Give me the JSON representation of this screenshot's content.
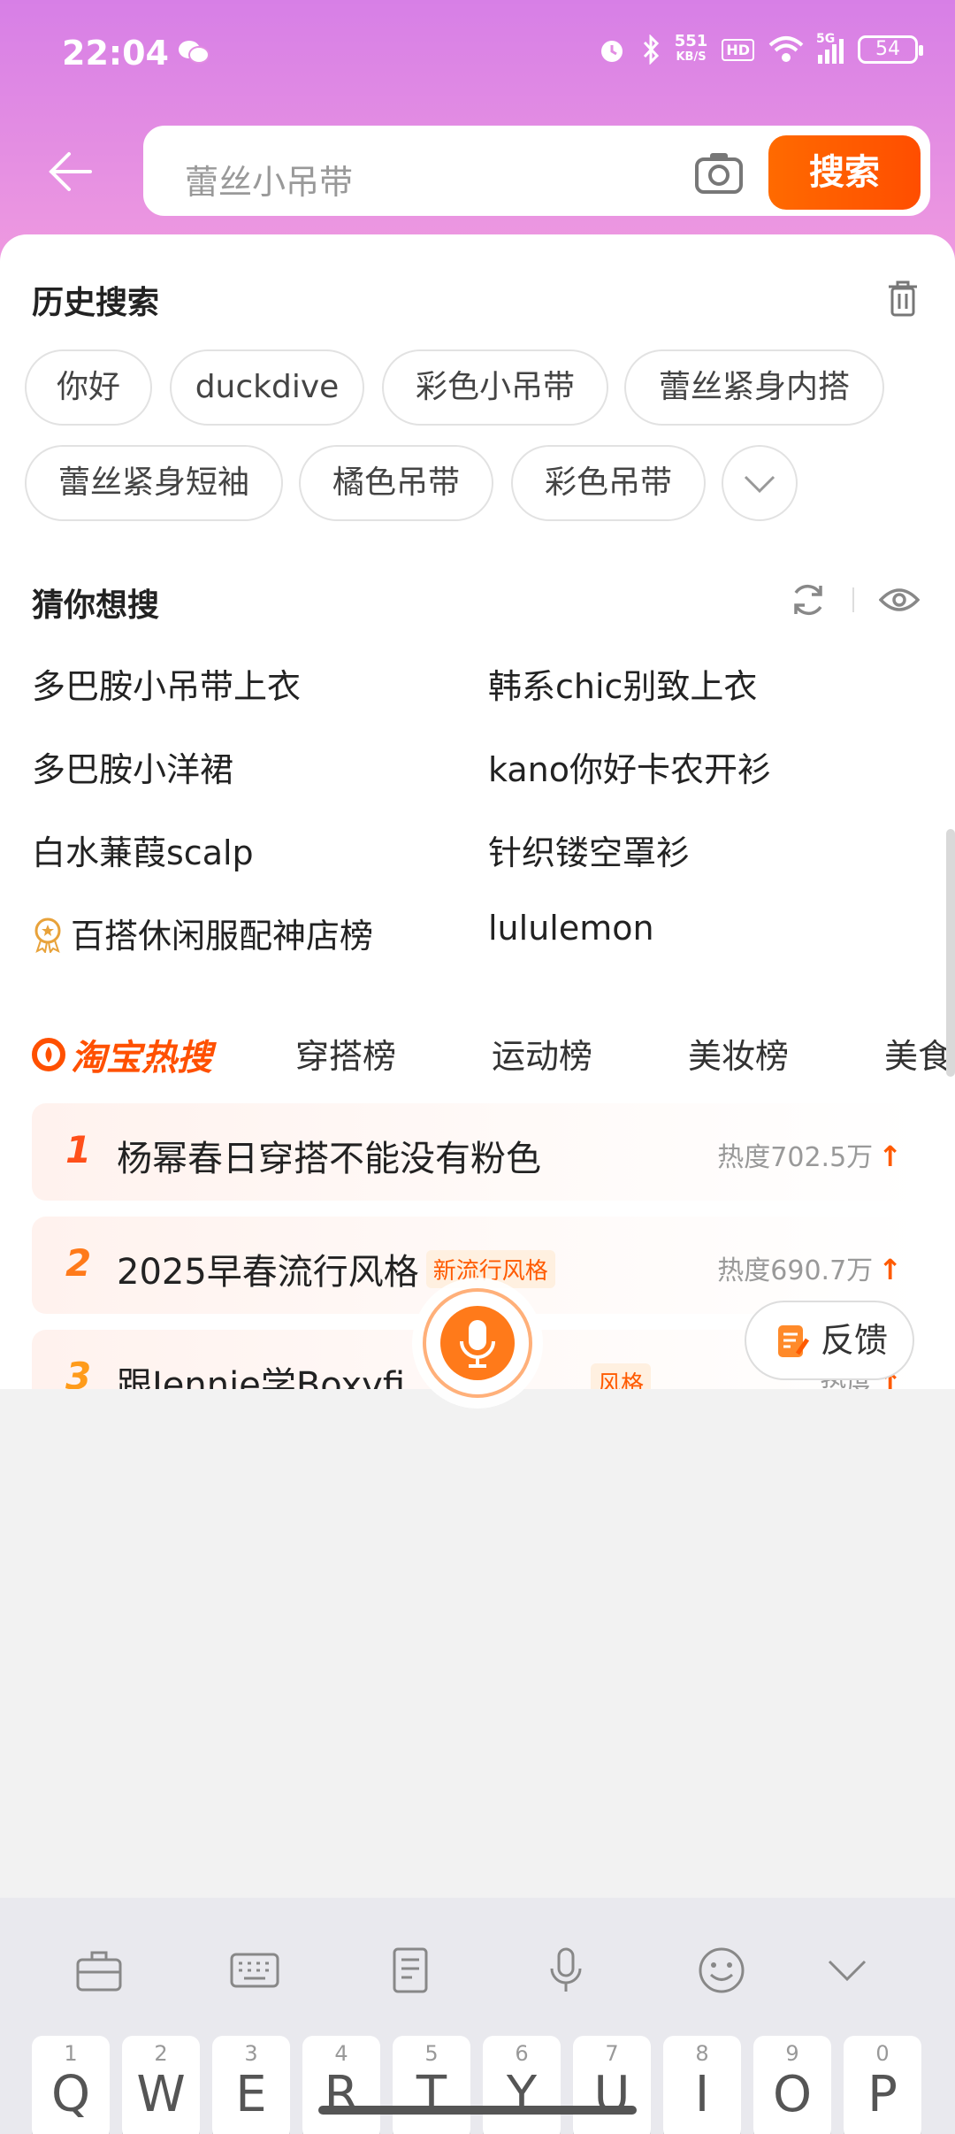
{
  "status_bar": {
    "time": "22:04",
    "net_speed_value": "551",
    "net_speed_unit": "KB/S",
    "hd": "HD",
    "network": "5G",
    "battery": "54"
  },
  "search": {
    "placeholder": "蕾丝小吊带",
    "button": "搜索"
  },
  "history": {
    "title": "历史搜索",
    "chips": [
      "你好",
      "duckdive",
      "彩色小吊带",
      "蕾丝紧身内搭",
      "蕾丝紧身短袖",
      "橘色吊带",
      "彩色吊带"
    ]
  },
  "guess": {
    "title": "猜你想搜",
    "items": [
      "多巴胺小吊带上衣",
      "韩系chic别致上衣",
      "多巴胺小洋裙",
      "kano你好卡农开衫",
      "白水蒹葭scalp",
      "针织镂空罩衫",
      "百搭休闲服配神店榜",
      "lululemon"
    ]
  },
  "hot": {
    "brand": "淘宝热搜",
    "tabs": [
      "穿搭榜",
      "运动榜",
      "美妆榜",
      "美食"
    ],
    "rows": [
      {
        "rank": "1",
        "title": "杨幂春日穿搭不能没有粉色",
        "tag": "",
        "heat": "热度702.5万"
      },
      {
        "rank": "2",
        "title": "2025早春流行风格",
        "tag": "新流行风格",
        "heat": "热度690.7万"
      },
      {
        "rank": "3",
        "title": "跟Jennie学Boxyfi",
        "tag": "风格",
        "heat": "热度"
      }
    ]
  },
  "feedback": "反馈",
  "keyboard": {
    "keys": [
      {
        "num": "1",
        "ch": "Q"
      },
      {
        "num": "2",
        "ch": "W"
      },
      {
        "num": "3",
        "ch": "E"
      },
      {
        "num": "4",
        "ch": "R"
      },
      {
        "num": "5",
        "ch": "T"
      },
      {
        "num": "6",
        "ch": "Y"
      },
      {
        "num": "7",
        "ch": "U"
      },
      {
        "num": "8",
        "ch": "I"
      },
      {
        "num": "9",
        "ch": "O"
      },
      {
        "num": "0",
        "ch": "P"
      }
    ]
  },
  "colors": {
    "accent": "#ff5000",
    "header_gradient_top": "#d77fe6"
  }
}
